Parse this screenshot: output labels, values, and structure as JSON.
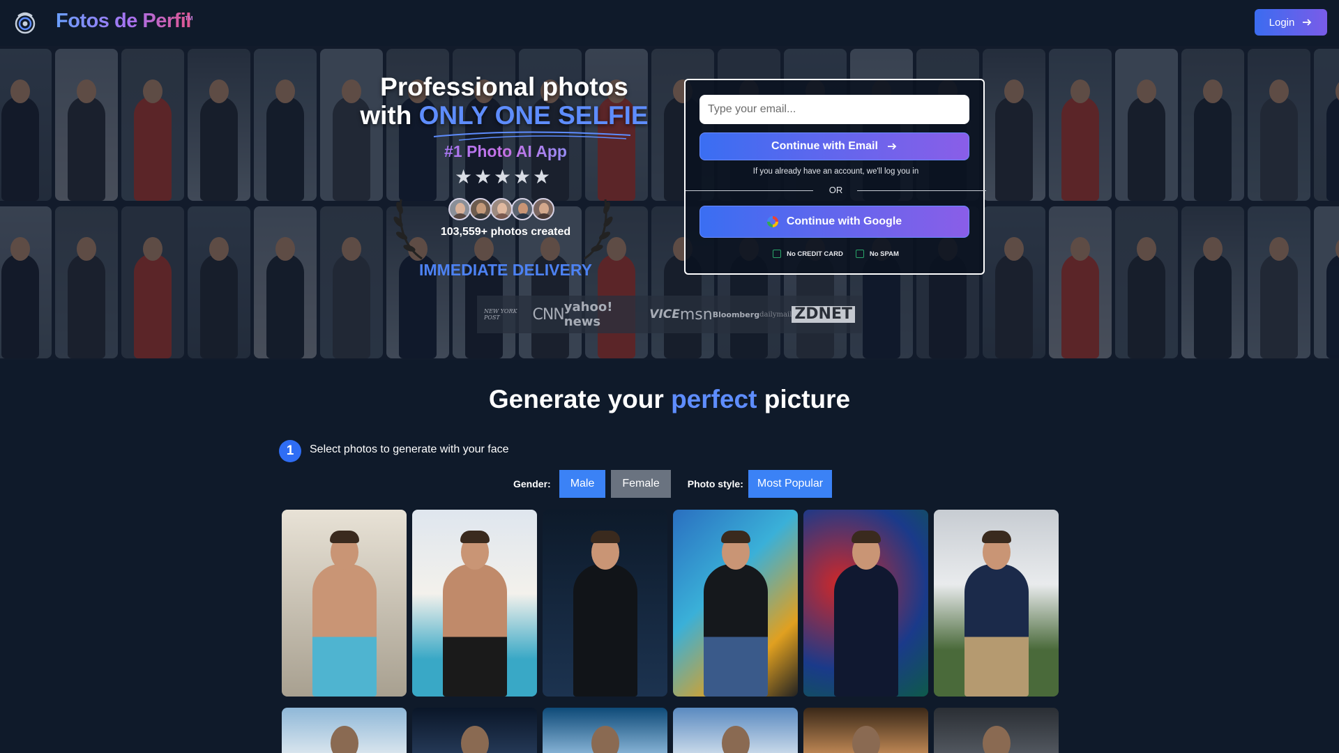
{
  "header": {
    "brand": "Fotos de Perfil",
    "trademark": "TM",
    "login_label": "Login",
    "logo_icon": "camera-swirl-icon"
  },
  "hero": {
    "headline_line1": "Professional photos",
    "headline_with": "with",
    "headline_highlight": "ONLY ONE SELFIE",
    "rank": "#1 Photo AI App",
    "stars": 5,
    "photos_created": "103,559+ photos created",
    "delivery": "IMMEDIATE DELIVERY",
    "press": [
      "NEW YORK POST",
      "CNN",
      "yahoo! news",
      "VICE",
      "msn",
      "Bloomberg",
      "dailymail",
      "ZDNET"
    ]
  },
  "signup": {
    "email_placeholder": "Type your email...",
    "continue_email": "Continue with Email",
    "account_note": "If you already have an account, we'll log you in",
    "or": "OR",
    "continue_google": "Continue with Google",
    "no_credit_card": "No CREDIT CARD",
    "no_spam": "No SPAM"
  },
  "generate": {
    "title_pre": "Generate your",
    "title_highlight": "perfect",
    "title_post": "picture",
    "step_number": "1",
    "step_text": "Select photos to generate with your face",
    "gender_label": "Gender:",
    "male": "Male",
    "female": "Female",
    "style_label": "Photo style:",
    "style_value": "Most Popular"
  },
  "colors": {
    "background": "#0f1a2a",
    "accent": "#3b82f6",
    "highlight_text": "#5e8dff"
  }
}
